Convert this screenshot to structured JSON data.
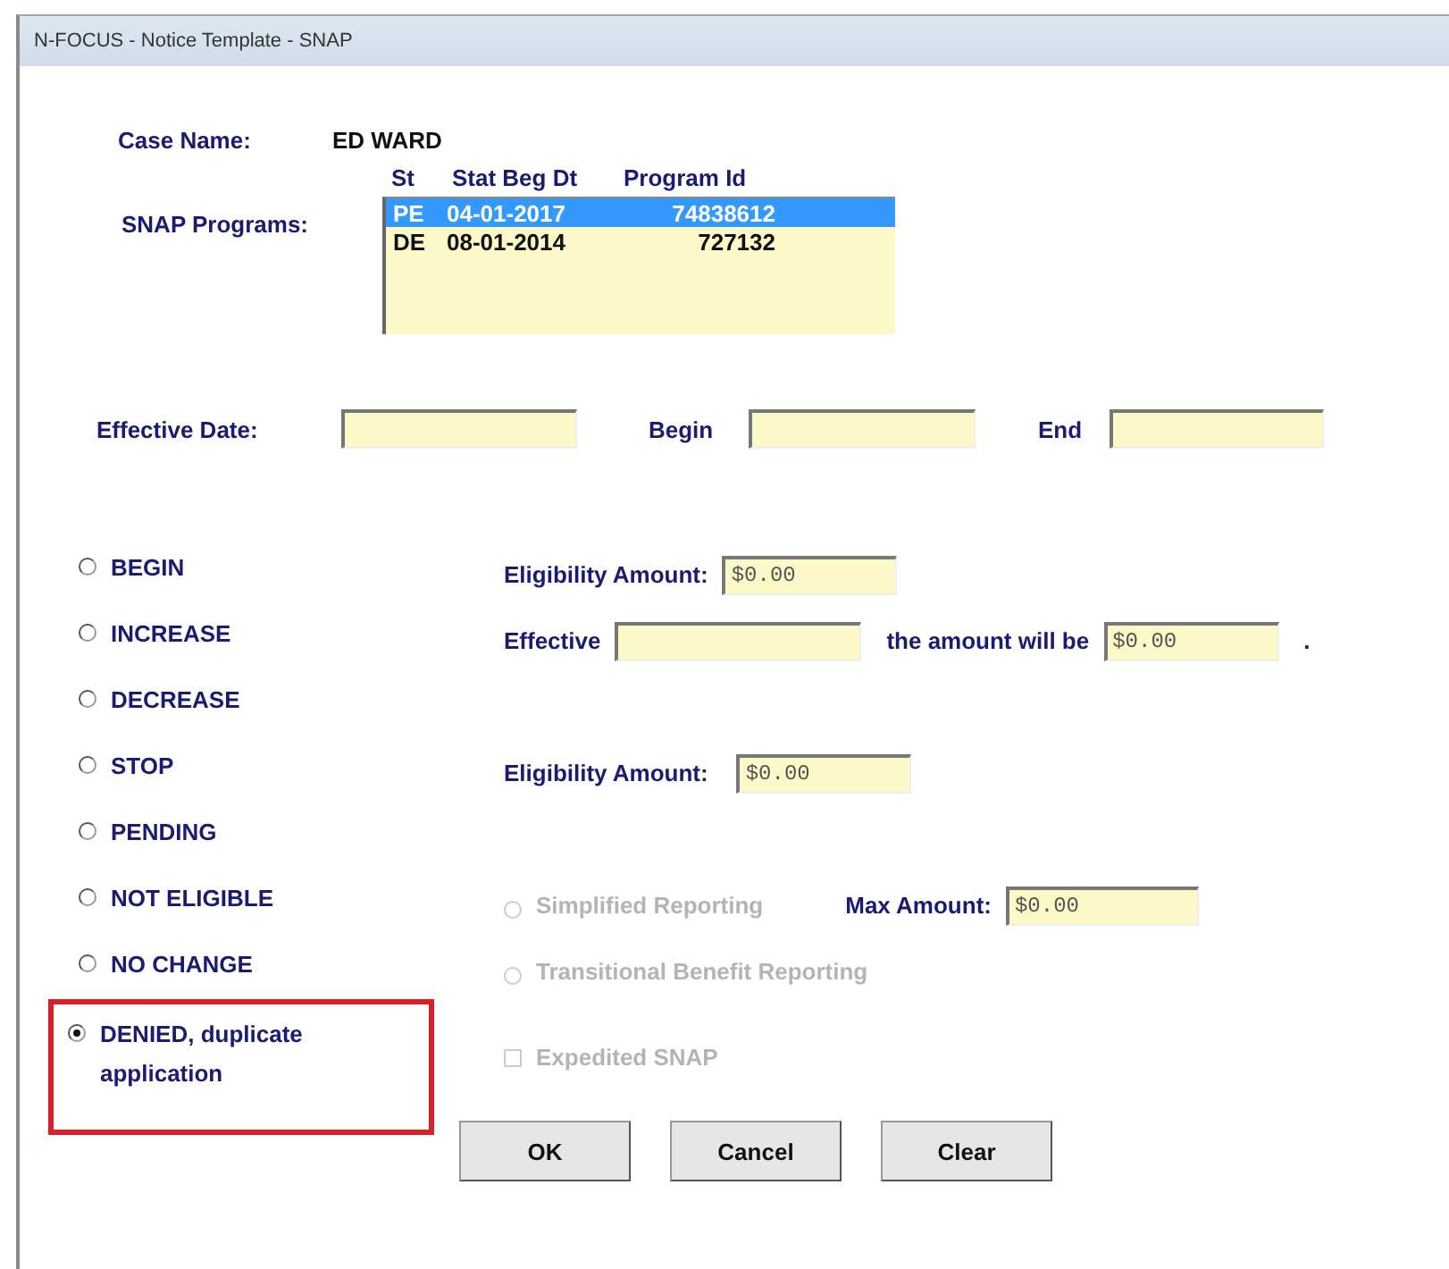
{
  "window": {
    "title": "N-FOCUS - Notice Template - SNAP"
  },
  "case_name": {
    "label": "Case Name:",
    "value": "ED WARD"
  },
  "programs": {
    "label": "SNAP Programs:",
    "columns": [
      "St",
      "Stat Beg Dt",
      "Program Id"
    ],
    "rows": [
      {
        "cells": [
          "PE",
          "04-01-2017",
          "74838612"
        ],
        "selected": true
      },
      {
        "cells": [
          "DE",
          "08-01-2014",
          "727132"
        ],
        "selected": false
      }
    ]
  },
  "dates": [
    {
      "label": "Effective Date:"
    },
    {
      "label": "Begin"
    },
    {
      "label": "End"
    }
  ],
  "actions": [
    {
      "label": "BEGIN",
      "selected": false,
      "highlighted": false
    },
    {
      "label": "INCREASE",
      "selected": false,
      "highlighted": false
    },
    {
      "label": "DECREASE",
      "selected": false,
      "highlighted": false
    },
    {
      "label": "STOP",
      "selected": false,
      "highlighted": false
    },
    {
      "label": "PENDING",
      "selected": false,
      "highlighted": false
    },
    {
      "label": "NOT ELIGIBLE",
      "selected": false,
      "highlighted": false
    },
    {
      "label": "NO CHANGE",
      "selected": false,
      "highlighted": false
    },
    {
      "label": "DENIED, duplicate application",
      "selected": true,
      "highlighted": true
    }
  ],
  "details": [
    {
      "kind": "amount",
      "label": "Eligibility Amount:",
      "value": "$0.00"
    },
    {
      "kind": "change",
      "label": "Effective",
      "middle": "the amount will be",
      "value": "$0.00",
      "end": "."
    },
    {
      "kind": "amount",
      "label": "Eligibility Amount:",
      "value": "$0.00"
    },
    {
      "kind": "radio",
      "label": "Simplified Reporting",
      "selected": false,
      "disabled": true,
      "extra": {
        "label": "Max Amount:",
        "value": "$0.00"
      }
    },
    {
      "kind": "radio",
      "label": "Transitional Benefit Reporting",
      "selected": false,
      "disabled": true
    },
    {
      "kind": "checkbox",
      "label": "Expedited SNAP",
      "checked": false,
      "disabled": true
    }
  ],
  "buttons": [
    "OK",
    "Cancel",
    "Clear"
  ]
}
